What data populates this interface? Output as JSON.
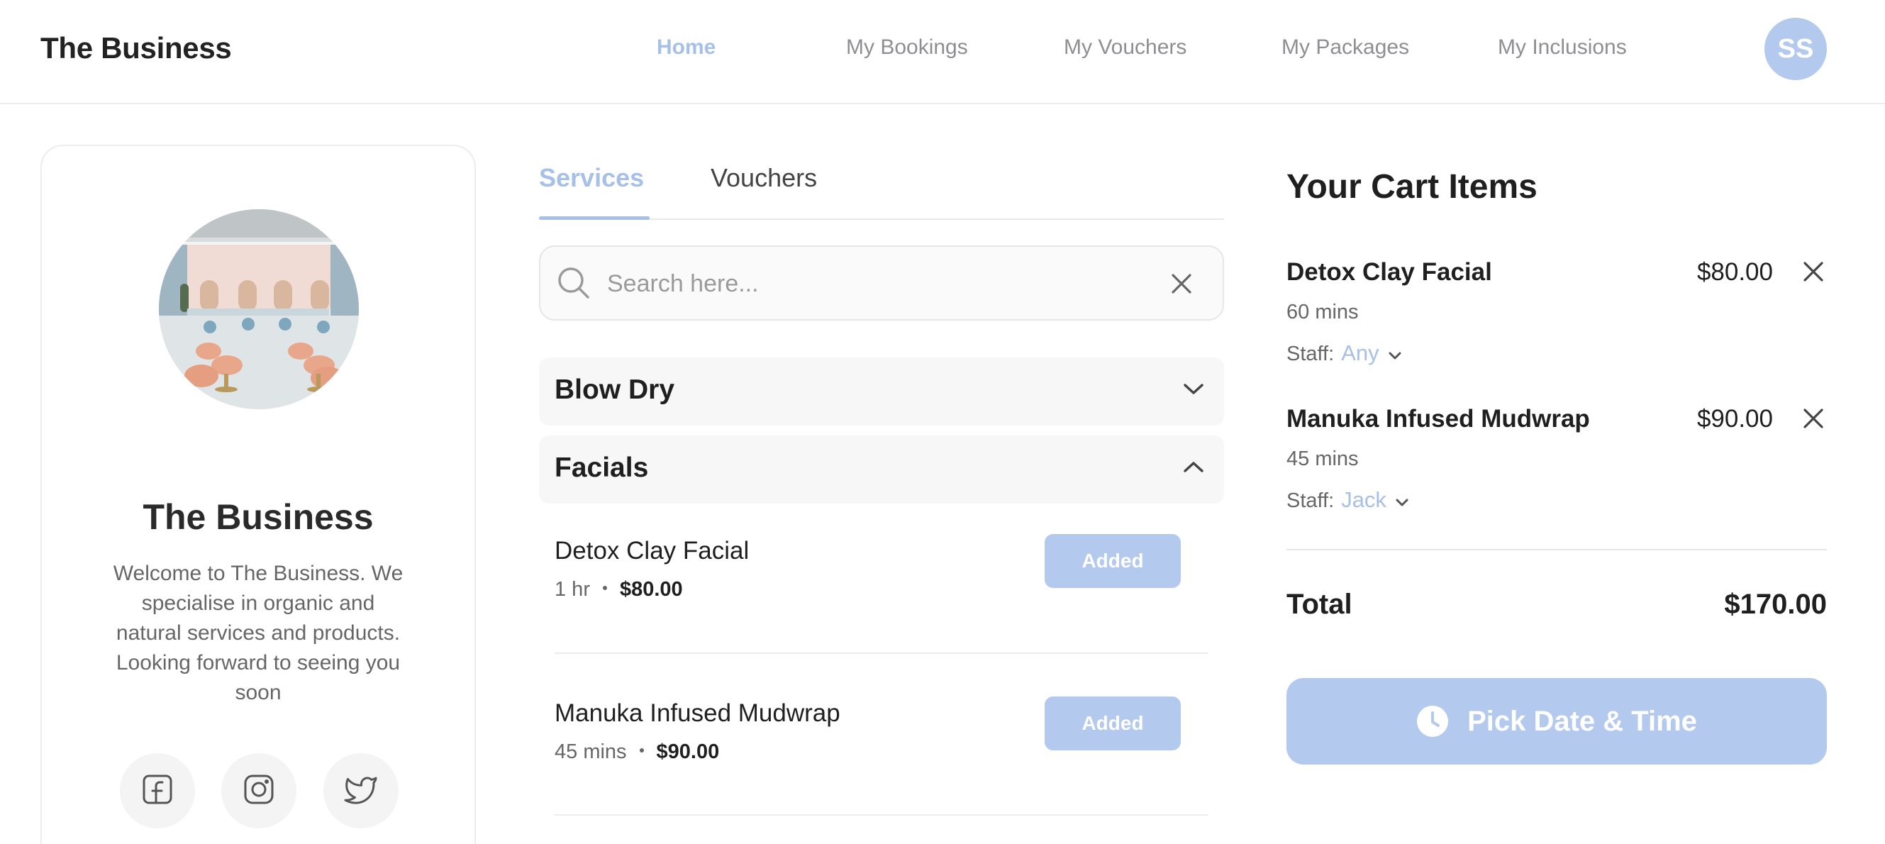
{
  "header": {
    "brand": "The Business",
    "nav": [
      {
        "label": "Home",
        "active": true
      },
      {
        "label": "My Bookings",
        "active": false
      },
      {
        "label": "My Vouchers",
        "active": false
      },
      {
        "label": "My Packages",
        "active": false
      },
      {
        "label": "My Inclusions",
        "active": false
      }
    ],
    "avatar_initials": "SS"
  },
  "profile": {
    "name": "The Business",
    "description": "Welcome to The Business. We specialise in organic and natural services and products. Looking forward to seeing you soon",
    "socials": [
      "facebook-icon",
      "instagram-icon",
      "twitter-icon"
    ]
  },
  "tabs": [
    {
      "label": "Services",
      "active": true
    },
    {
      "label": "Vouchers",
      "active": false
    }
  ],
  "search": {
    "placeholder": "Search here...",
    "value": ""
  },
  "categories": [
    {
      "label": "Blow Dry",
      "expanded": false
    },
    {
      "label": "Facials",
      "expanded": true,
      "services": [
        {
          "name": "Detox Clay Facial",
          "duration": "1 hr",
          "price": "$80.00",
          "button": "Added"
        },
        {
          "name": "Manuka Infused Mudwrap",
          "duration": "45 mins",
          "price": "$90.00",
          "button": "Added"
        }
      ]
    }
  ],
  "cart": {
    "title": "Your Cart Items",
    "staff_label": "Staff:",
    "items": [
      {
        "name": "Detox Clay Facial",
        "price": "$80.00",
        "duration": "60 mins",
        "staff": "Any"
      },
      {
        "name": "Manuka Infused Mudwrap",
        "price": "$90.00",
        "duration": "45 mins",
        "staff": "Jack"
      }
    ],
    "total_label": "Total",
    "total_value": "$170.00",
    "cta": "Pick Date & Time"
  },
  "colors": {
    "accent": "#a7c0e8",
    "button_fill": "#b3c9ee",
    "text": "#1f1f1f",
    "muted": "#666666"
  }
}
